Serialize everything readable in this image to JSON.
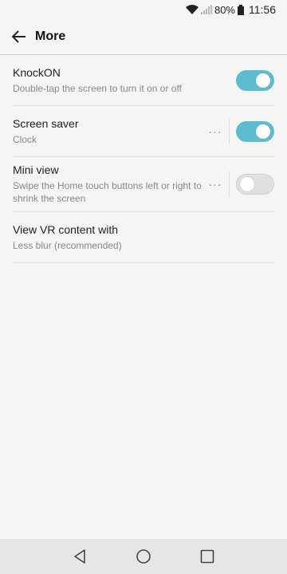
{
  "status": {
    "battery": "80%",
    "time": "11:56",
    "icons": [
      "wifi-icon",
      "signal-icon",
      "battery-icon"
    ]
  },
  "appbar": {
    "title": "More",
    "back_icon": "back-arrow-icon"
  },
  "settings": [
    {
      "label": "KnockON",
      "sub": "Double-tap the screen to turn it on or off",
      "toggle": "on",
      "more": false
    },
    {
      "label": "Screen saver",
      "sub": "Clock",
      "toggle": "on",
      "more": true
    },
    {
      "label": "Mini view",
      "sub": "Swipe the Home touch buttons left or right to shrink the screen",
      "toggle": "off",
      "more": true
    },
    {
      "label": "View VR content with",
      "sub": "Less blur (recommended)",
      "toggle": null,
      "more": false
    }
  ],
  "more_glyph": "···",
  "colors": {
    "toggle_on": "#5bbdd0",
    "toggle_off": "#e0e0e0"
  },
  "navbar": {
    "buttons": [
      "back-triangle-icon",
      "home-circle-icon",
      "recents-square-icon"
    ]
  }
}
